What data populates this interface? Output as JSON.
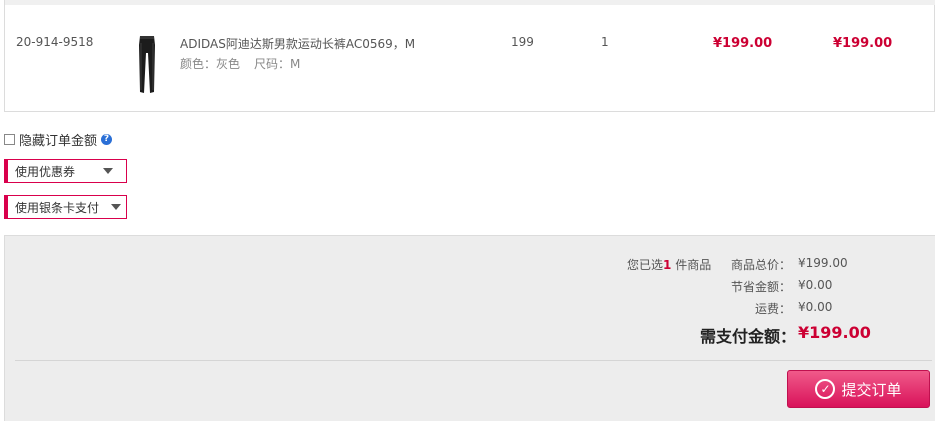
{
  "order_item": {
    "sku": "20-914-9518",
    "name": "ADIDAS阿迪达斯男款运动长裤AC0569，M",
    "color_label": "颜色：",
    "color_value": "灰色",
    "size_label": "尺码：",
    "size_value": "M",
    "unit_price": "199",
    "quantity": "1",
    "price": "¥199.00",
    "subtotal": "¥199.00",
    "thumbnail_icon": "pants-thumbnail"
  },
  "options": {
    "hide_amount_label": "隐藏订单金额",
    "help_icon": "help-icon",
    "coupon_label": "使用优惠券",
    "card_label": "使用银条卡支付"
  },
  "summary": {
    "selected_prefix": "您已选",
    "selected_count": "1",
    "selected_suffix": " 件商品",
    "total_label": "商品总价：",
    "total_value": "¥199.00",
    "saved_label": "节省金额：",
    "saved_value": "¥0.00",
    "shipping_label": "运费：",
    "shipping_value": "¥0.00",
    "pay_label": "需支付金额：",
    "pay_value": "¥199.00",
    "submit_label": "提交订单"
  },
  "colors": {
    "accent": "#d9004c",
    "price": "#cc0033"
  }
}
